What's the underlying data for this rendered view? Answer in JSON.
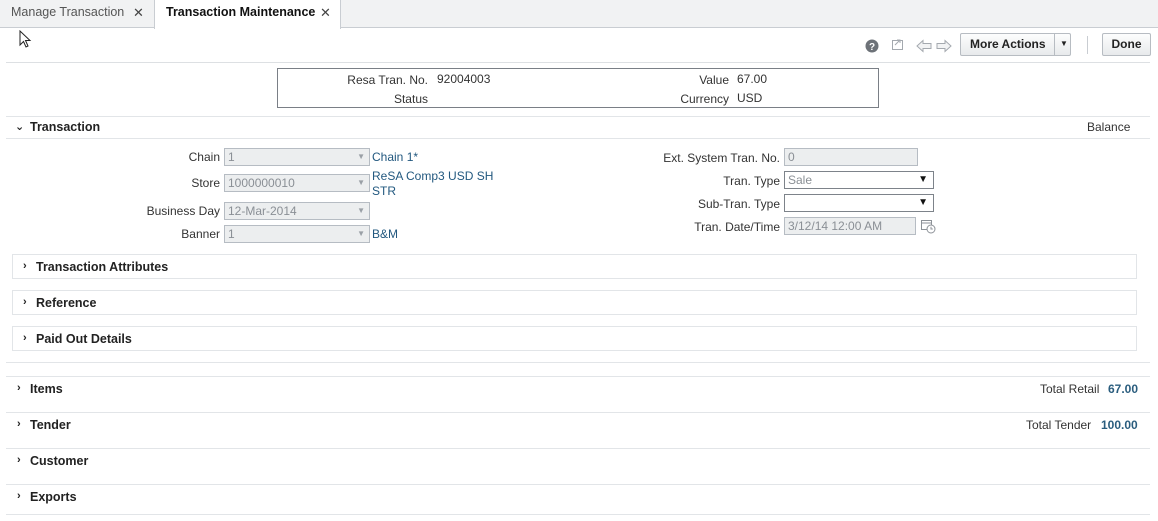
{
  "tabs": [
    {
      "label": "Manage Transaction",
      "active": false
    },
    {
      "label": "Transaction Maintenance",
      "active": true
    }
  ],
  "toolbar": {
    "help_icon": "question-circle-icon",
    "export_icon": "export-icon",
    "prev_icon": "arrow-left-icon",
    "next_icon": "arrow-right-icon",
    "more_actions_label": "More Actions",
    "done_label": "Done"
  },
  "summary": {
    "resa_tran_no_label": "Resa Tran. No.",
    "resa_tran_no_value": "92004003",
    "status_label": "Status",
    "status_value": "",
    "value_label": "Value",
    "value_value": "67.00",
    "currency_label": "Currency",
    "currency_value": "USD"
  },
  "transaction": {
    "title": "Transaction",
    "balance_label": "Balance",
    "chain_label": "Chain",
    "chain_value": "1",
    "chain_desc": "Chain 1*",
    "store_label": "Store",
    "store_value": "1000000010",
    "store_desc_line1": "ReSA Comp3 USD SH",
    "store_desc_line2": "STR",
    "business_day_label": "Business Day",
    "business_day_value": "12-Mar-2014",
    "banner_label": "Banner",
    "banner_value": "1",
    "banner_desc": "B&M",
    "ext_system_label": "Ext. System Tran. No.",
    "ext_system_value": "0",
    "tran_type_label": "Tran. Type",
    "tran_type_value": "Sale",
    "sub_tran_type_label": "Sub-Tran. Type",
    "sub_tran_type_value": "",
    "tran_date_label": "Tran. Date/Time",
    "tran_date_value": "3/12/14 12:00 AM"
  },
  "subsections": [
    {
      "label": "Transaction Attributes"
    },
    {
      "label": "Reference"
    },
    {
      "label": "Paid Out Details"
    }
  ],
  "sections": [
    {
      "label": "Items",
      "total_label": "Total Retail",
      "total_value": "67.00"
    },
    {
      "label": "Tender",
      "total_label": "Total Tender",
      "total_value": "100.00"
    },
    {
      "label": "Customer",
      "total_label": "",
      "total_value": ""
    },
    {
      "label": "Exports",
      "total_label": "",
      "total_value": ""
    }
  ],
  "colors": {
    "accent": "#2a5d7e",
    "link": "#22587f"
  }
}
